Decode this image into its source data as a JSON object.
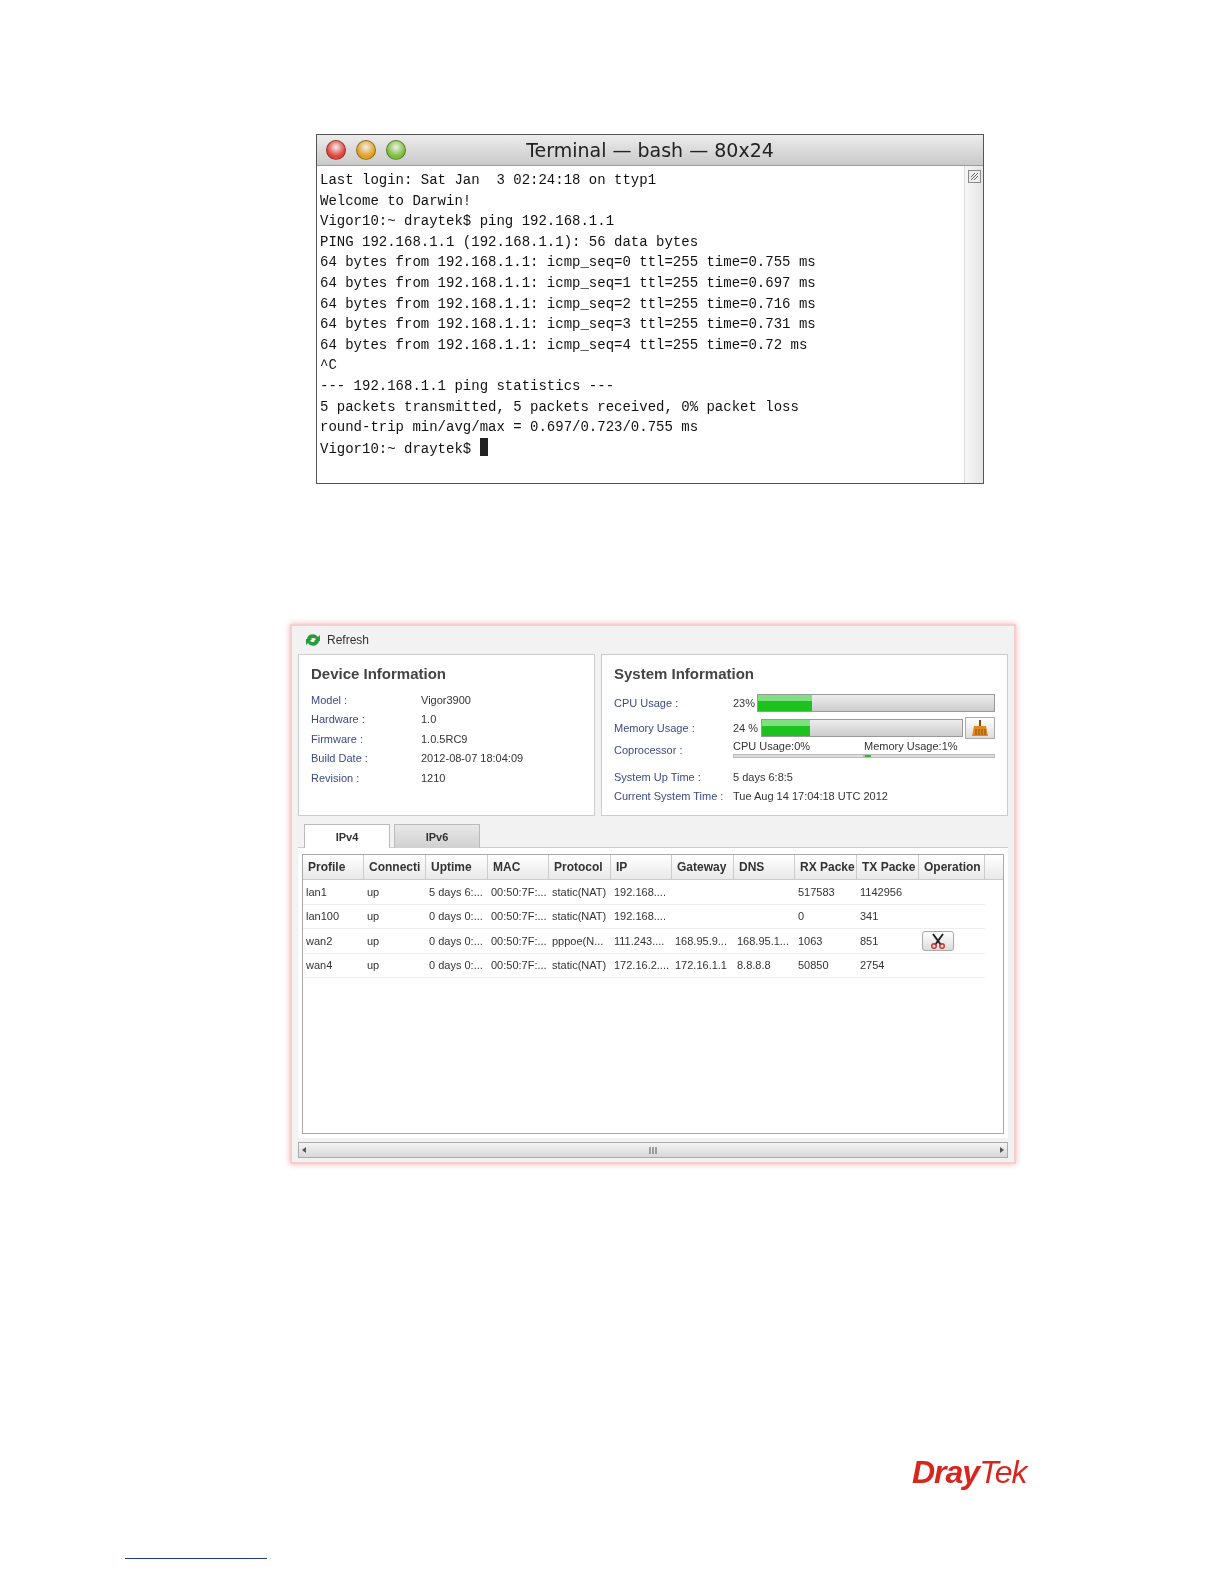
{
  "terminal": {
    "title": "Terminal — bash — 80x24",
    "lines": [
      "Last login: Sat Jan  3 02:24:18 on ttyp1",
      "Welcome to Darwin!",
      "Vigor10:~ draytek$ ping 192.168.1.1",
      "PING 192.168.1.1 (192.168.1.1): 56 data bytes",
      "64 bytes from 192.168.1.1: icmp_seq=0 ttl=255 time=0.755 ms",
      "64 bytes from 192.168.1.1: icmp_seq=1 ttl=255 time=0.697 ms",
      "64 bytes from 192.168.1.1: icmp_seq=2 ttl=255 time=0.716 ms",
      "64 bytes from 192.168.1.1: icmp_seq=3 ttl=255 time=0.731 ms",
      "64 bytes from 192.168.1.1: icmp_seq=4 ttl=255 time=0.72 ms",
      "^C",
      "--- 192.168.1.1 ping statistics ---",
      "5 packets transmitted, 5 packets received, 0% packet loss",
      "round-trip min/avg/max = 0.697/0.723/0.755 ms"
    ],
    "prompt": "Vigor10:~ draytek$ "
  },
  "dashboard": {
    "refresh_label": "Refresh",
    "device_info": {
      "title": "Device Information",
      "fields": [
        {
          "label": "Model :",
          "value": "Vigor3900"
        },
        {
          "label": "Hardware :",
          "value": "1.0"
        },
        {
          "label": "Firmware :",
          "value": "1.0.5RC9"
        },
        {
          "label": "Build Date :",
          "value": "2012-08-07 18:04:09"
        },
        {
          "label": "Revision :",
          "value": "1210"
        }
      ]
    },
    "system_info": {
      "title": "System Information",
      "cpu": {
        "label": "CPU Usage :",
        "reading": "23%",
        "level": 0.23
      },
      "memory": {
        "label": "Memory Usage :",
        "reading": "24 %",
        "level": 0.24
      },
      "coprocessor": {
        "label": "Coprocessor :",
        "cpu": {
          "text": "CPU Usage:0%",
          "level": 0
        },
        "memory": {
          "text": "Memory Usage:1%",
          "level": 0.01
        }
      },
      "uptime": {
        "label": "System Up Time :",
        "value": "5 days 6:8:5"
      },
      "current_time": {
        "label": "Current System Time :",
        "value": "Tue Aug 14 17:04:18 UTC 2012"
      }
    },
    "tabs": [
      {
        "label": "IPv4",
        "selected": true
      },
      {
        "label": "IPv6",
        "selected": false
      }
    ],
    "table": {
      "columns": [
        "Profile",
        "Connecti",
        "Uptime",
        "MAC",
        "Protocol",
        "IP",
        "Gateway",
        "DNS",
        "RX Packe",
        "TX Packe",
        "Operation"
      ],
      "rows": [
        {
          "cells": [
            "lan1",
            "up",
            "5 days 6:...",
            "00:50:7F:...",
            "static(NAT)",
            "192.168....",
            "",
            "",
            "517583",
            "1142956"
          ],
          "disconnect_button": false
        },
        {
          "cells": [
            "lan100",
            "up",
            "0 days 0:...",
            "00:50:7F:...",
            "static(NAT)",
            "192.168....",
            "",
            "",
            "0",
            "341"
          ],
          "disconnect_button": false
        },
        {
          "cells": [
            "wan2",
            "up",
            "0 days 0:...",
            "00:50:7F:...",
            "pppoe(N...",
            "111.243....",
            "168.95.9...",
            "168.95.1...",
            "1063",
            "851"
          ],
          "disconnect_button": true
        },
        {
          "cells": [
            "wan4",
            "up",
            "0 days 0:...",
            "00:50:7F:...",
            "static(NAT)",
            "172.16.2....",
            "172.16.1.1",
            "8.8.8.8",
            "50850",
            "2754"
          ],
          "disconnect_button": false
        }
      ]
    }
  },
  "logo": {
    "text_1": "Dray",
    "text_2": "Tek"
  }
}
